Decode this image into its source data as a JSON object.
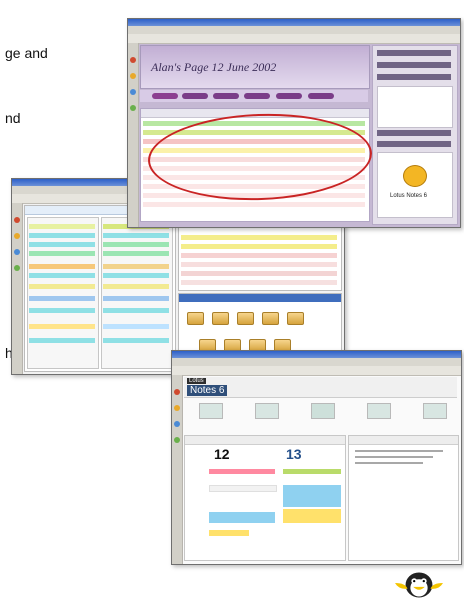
{
  "bullets": {
    "line1": "ge and",
    "line2": "nd",
    "line3": "h"
  },
  "screen1": {
    "banner": "Alan's Page 12 June 2002",
    "logo": "Lotus Notes 6"
  },
  "screen3": {
    "brand_small": "Lotus",
    "brand_big": "Notes 6",
    "day1": "12",
    "day2": "13"
  },
  "mascot": "penguin-mascot"
}
